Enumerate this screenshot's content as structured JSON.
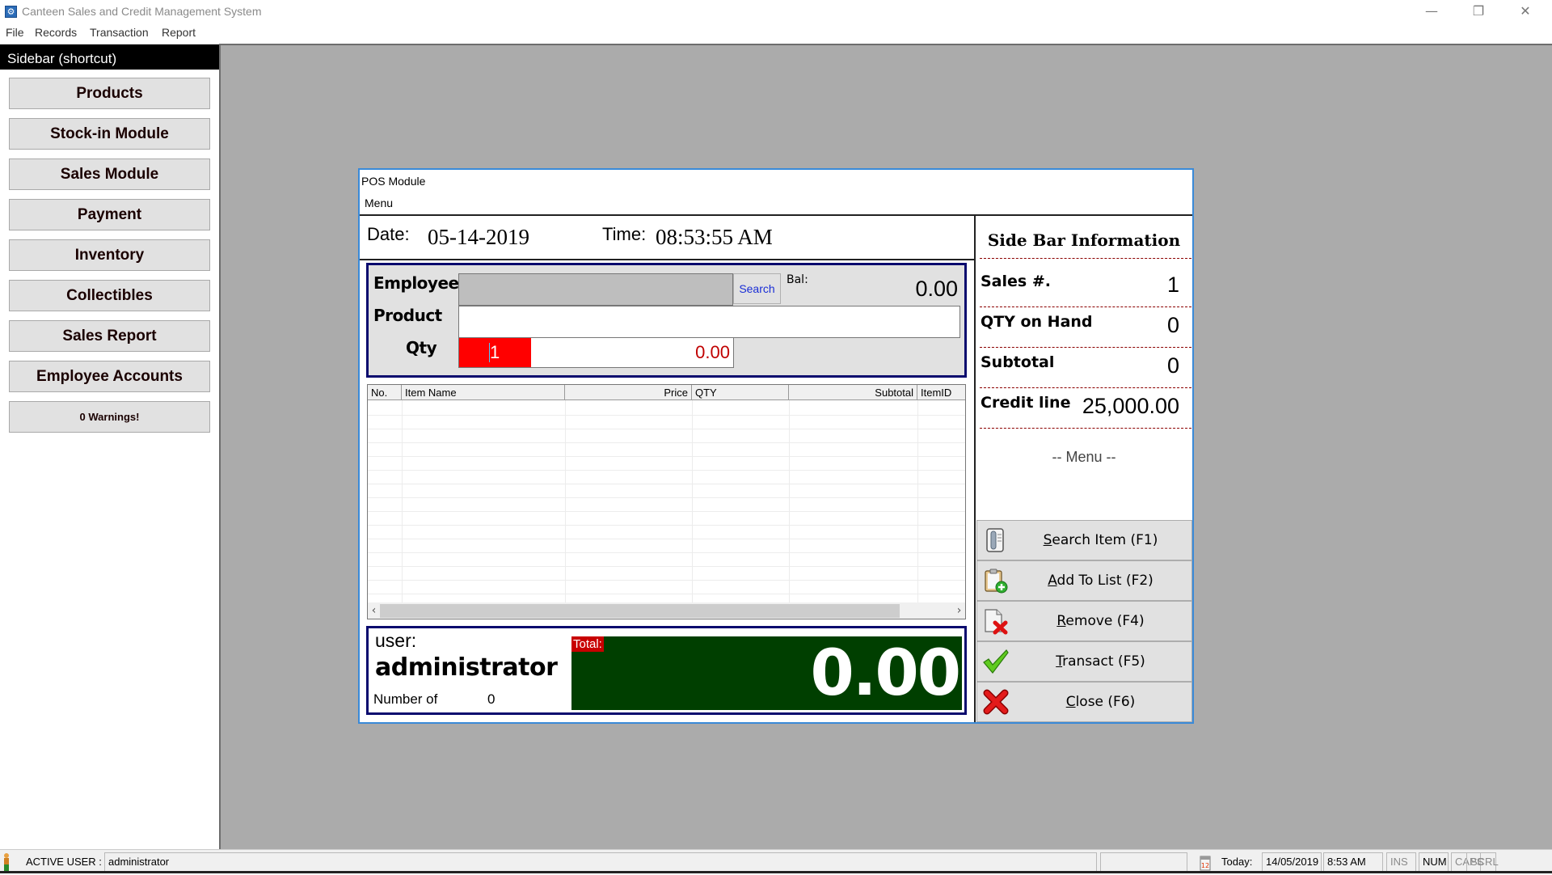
{
  "app": {
    "title": "Canteen Sales and Credit Management System",
    "icon": "gear-app-icon",
    "window_controls": {
      "minimize": "—",
      "restore": "❐",
      "close": "✕"
    }
  },
  "menubar": {
    "items": [
      "File",
      "Records",
      "Transaction",
      "Report"
    ]
  },
  "sidebar": {
    "header": "Sidebar (shortcut)",
    "buttons": [
      "Products",
      "Stock-in Module",
      "Sales Module",
      "Payment",
      "Inventory",
      "Collectibles",
      "Sales Report",
      "Employee Accounts",
      "0 Warnings!"
    ]
  },
  "pos": {
    "title": "POS Module",
    "menu": "Menu",
    "date_label": "Date:",
    "date_value": "05-14-2019",
    "time_label": "Time:",
    "time_value": "08:53:55 AM",
    "input": {
      "employee_label": "Employee",
      "employee_value": "",
      "search_label": "Search",
      "balance_label": "Bal:",
      "balance_value": "0.00",
      "product_label": "Product",
      "product_value": "",
      "qty_label": "Qty",
      "qty_value": "1",
      "qty_price": "0.00"
    },
    "grid": {
      "columns": [
        "No.",
        "Item Name",
        "Price",
        "QTY",
        "Subtotal",
        "ItemID"
      ],
      "rows": []
    },
    "summary": {
      "user_label": "user:",
      "user_name": "administrator",
      "number_label": "Number of",
      "number_value": "0",
      "total_label": "Total:",
      "total_value": "0.00"
    },
    "side_info": {
      "title": "Side Bar Information",
      "items": [
        {
          "label": "Sales #.",
          "value": "1"
        },
        {
          "label": "QTY on Hand",
          "value": "0"
        },
        {
          "label": "Subtotal",
          "value": "0"
        },
        {
          "label": "Credit line",
          "value": "25,000.00"
        }
      ],
      "menu_caption": "-- Menu --"
    },
    "menu_buttons": [
      {
        "hotkey_letter": "S",
        "rest": "earch Item (F1)",
        "icon": "search-document-icon"
      },
      {
        "hotkey_letter": "A",
        "rest": "dd To List (F2)",
        "icon": "add-clipboard-icon"
      },
      {
        "hotkey_letter": "R",
        "rest": "emove (F4)",
        "icon": "remove-document-icon"
      },
      {
        "hotkey_letter": "T",
        "rest": "ransact (F5)",
        "icon": "checkmark-icon"
      },
      {
        "hotkey_letter": "C",
        "rest": "lose (F6)",
        "icon": "close-x-icon"
      }
    ]
  },
  "statusbar": {
    "active_user_label": "ACTIVE USER :",
    "active_user_value": "administrator",
    "today_label": "Today:",
    "date": "14/05/2019",
    "time": "8:53 AM",
    "ins": "INS",
    "num": "NUM",
    "caps": "CAPS",
    "scrl": "SCRL"
  },
  "colors": {
    "total_bg": "#003f00",
    "total_label_bg": "#c80000",
    "qty_bg": "#ff0000",
    "panel_border": "#0a0a6e",
    "window_border": "#3a8ad8",
    "mdi_bg": "#ababab"
  }
}
